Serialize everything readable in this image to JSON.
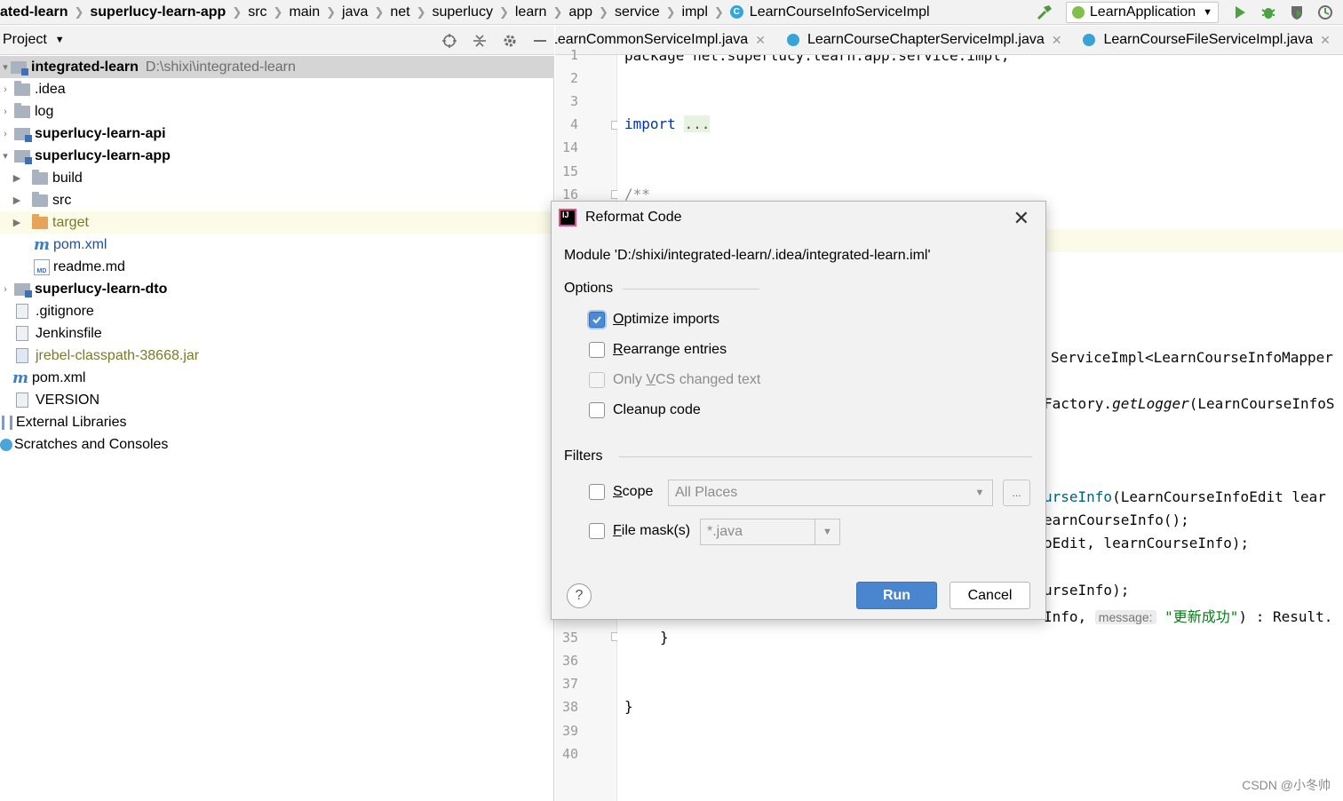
{
  "breadcrumbs": [
    "ated-learn",
    "superlucy-learn-app",
    "src",
    "main",
    "java",
    "net",
    "superlucy",
    "learn",
    "app",
    "service",
    "impl"
  ],
  "breadcrumb_class": "LearnCourseInfoServiceImpl",
  "run_config": "LearnApplication",
  "project_panel": {
    "title": "Project",
    "tree": [
      {
        "label": "integrated-learn",
        "hint": "D:\\shixi\\integrated-learn"
      },
      {
        "label": ".idea"
      },
      {
        "label": "log"
      },
      {
        "label": "superlucy-learn-api"
      },
      {
        "label": "superlucy-learn-app"
      },
      {
        "label": "build"
      },
      {
        "label": "src"
      },
      {
        "label": "target"
      },
      {
        "label": "pom.xml"
      },
      {
        "label": "readme.md"
      },
      {
        "label": "superlucy-learn-dto"
      },
      {
        "label": ".gitignore"
      },
      {
        "label": "Jenkinsfile"
      },
      {
        "label": "jrebel-classpath-38668.jar"
      },
      {
        "label": "pom.xml"
      },
      {
        "label": "VERSION"
      },
      {
        "label": "External Libraries"
      },
      {
        "label": "Scratches and Consoles"
      }
    ]
  },
  "editor": {
    "tabs": [
      "LearnCommonServiceImpl.java",
      "LearnCourseChapterServiceImpl.java",
      "LearnCourseFileServiceImpl.java"
    ],
    "line_numbers": [
      "1",
      "2",
      "3",
      "4",
      "14",
      "15",
      "16",
      "35",
      "36",
      "37",
      "38",
      "39",
      "40"
    ],
    "code": {
      "package_line": "package net.superlucy.learn.app.service.impl;",
      "import_kw": "import",
      "import_fold": "...",
      "javadoc_start": "/**",
      "frag_service_impl": "ServiceImpl<LearnCourseInfoMapper",
      "frag_factory_pre": "Factory.",
      "frag_factory_method": "getLogger",
      "frag_factory_post": "(LearnCourseInfoS",
      "frag_method_pre": "urseInfo",
      "frag_method_post": "(LearnCourseInfoEdit lear",
      "frag_new_info": "earnCourseInfo();",
      "frag_copy": "oEdit, learnCourseInfo);",
      "frag_update": "urseInfo);",
      "frag_result_pre": "Info, ",
      "frag_result_hint": "message:",
      "frag_result_str": "\"更新成功\"",
      "frag_result_post": ") : Result.",
      "brace_inner": "}",
      "brace_outer": "}"
    }
  },
  "dialog": {
    "title": "Reformat Code",
    "module_text": "Module 'D:/shixi/integrated-learn/.idea/integrated-learn.iml'",
    "options_label": "Options",
    "options": [
      {
        "mnemonic": "O",
        "rest": "ptimize imports",
        "checked": true
      },
      {
        "mnemonic": "R",
        "rest": "earrange entries",
        "checked": false
      },
      {
        "pre": "Only ",
        "mnemonic": "V",
        "rest": "CS changed text",
        "checked": false,
        "disabled": true
      },
      {
        "pre": "",
        "mnemonic": "",
        "rest": "Cleanup code",
        "checked": false
      }
    ],
    "filters_label": "Filters",
    "scope": {
      "mnemonic": "S",
      "rest": "cope",
      "value": "All Places",
      "browse": "..."
    },
    "file_mask": {
      "mnemonic": "F",
      "rest": "ile mask(s)",
      "value": "*.java"
    },
    "help": "?",
    "run_label": "Run",
    "cancel_label": "Cancel"
  },
  "watermark": "CSDN @小冬帅",
  "colors": {
    "accent": "#4a86cf",
    "keyword": "#0033b3",
    "string": "#067d17"
  }
}
